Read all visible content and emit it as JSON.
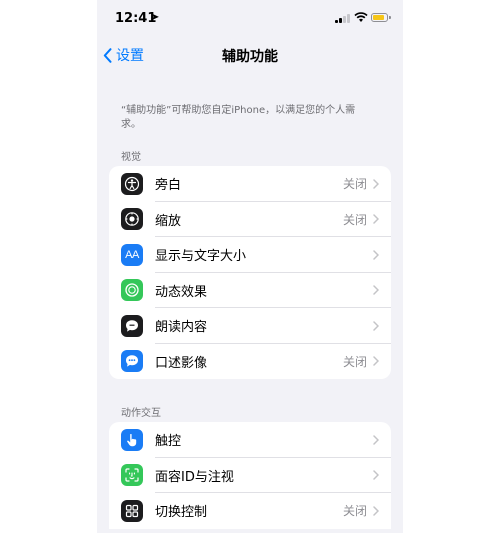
{
  "status": {
    "time": "12:41"
  },
  "nav": {
    "back_label": "设置",
    "title": "辅助功能"
  },
  "description": "“辅助功能”可帮助您自定iPhone，以满足您的个人需求。",
  "sections": [
    {
      "header": "视觉",
      "items": [
        {
          "label": "旁白",
          "value": "关闭",
          "icon": "voiceover-icon",
          "color": "#1c1c1e"
        },
        {
          "label": "缩放",
          "value": "关闭",
          "icon": "zoom-icon",
          "color": "#1c1c1e"
        },
        {
          "label": "显示与文字大小",
          "value": "",
          "icon": "text-size-icon",
          "color": "#1a7cf5"
        },
        {
          "label": "动态效果",
          "value": "",
          "icon": "motion-icon",
          "color": "#34c759"
        },
        {
          "label": "朗读内容",
          "value": "",
          "icon": "spoken-content-icon",
          "color": "#1c1c1e"
        },
        {
          "label": "口述影像",
          "value": "关闭",
          "icon": "audio-description-icon",
          "color": "#1a7cf5"
        }
      ]
    },
    {
      "header": "动作交互",
      "items": [
        {
          "label": "触控",
          "value": "",
          "icon": "touch-icon",
          "color": "#1a7cf5"
        },
        {
          "label": "面容ID与注视",
          "value": "",
          "icon": "face-id-icon",
          "color": "#34c759"
        },
        {
          "label": "切换控制",
          "value": "关闭",
          "icon": "switch-control-icon",
          "color": "#1c1c1e"
        }
      ]
    }
  ]
}
